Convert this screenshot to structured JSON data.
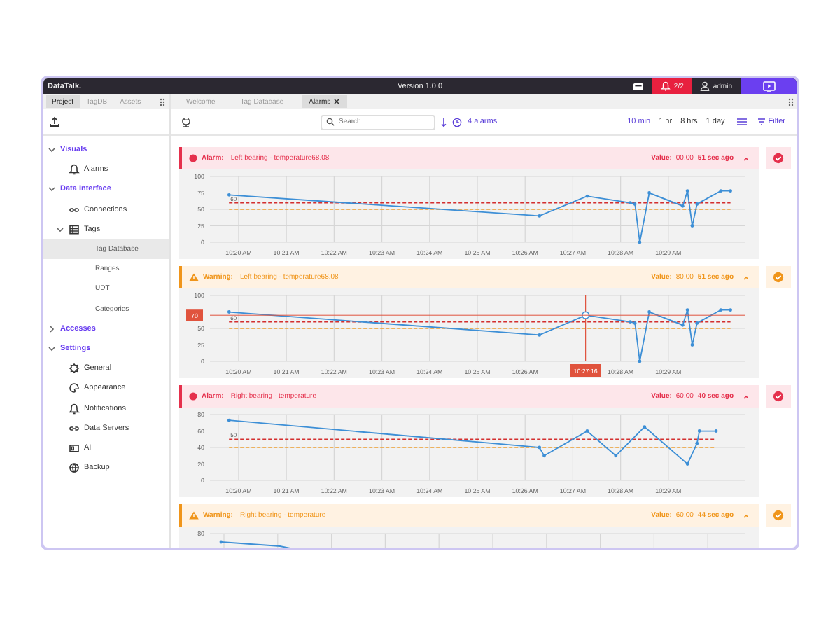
{
  "app": {
    "name": "DataTalk.",
    "version": "Version 1.0.0",
    "alarm_count": "2/2",
    "user": "admin"
  },
  "sidebar": {
    "tabs": [
      {
        "label": "Project",
        "selected": true
      },
      {
        "label": "TagDB",
        "selected": false
      },
      {
        "label": "Assets",
        "selected": false
      }
    ],
    "tree": [
      {
        "label": "Visuals",
        "selected": false,
        "expanded": true,
        "children": [
          {
            "label": "Alarms",
            "selected": false
          }
        ]
      },
      {
        "label": "Data Interface",
        "selected": false,
        "expanded": true,
        "children": [
          {
            "label": "Connections",
            "selected": false
          },
          {
            "label": "Tags",
            "selected": false,
            "expanded": true,
            "children": [
              {
                "label": "Tag Database",
                "selected": true
              },
              {
                "label": "Ranges",
                "selected": false
              },
              {
                "label": "UDT",
                "selected": false
              },
              {
                "label": "Categories",
                "selected": false
              }
            ]
          }
        ]
      },
      {
        "label": "Accesses",
        "selected": false,
        "expanded": false
      },
      {
        "label": "Settings",
        "selected": false,
        "expanded": true,
        "children": [
          {
            "label": "General",
            "selected": false
          },
          {
            "label": "Appearance",
            "selected": false
          },
          {
            "label": "Notifications",
            "selected": false
          },
          {
            "label": "Data Servers",
            "selected": false
          },
          {
            "label": "AI",
            "selected": false
          },
          {
            "label": "Backup",
            "selected": false
          }
        ]
      }
    ]
  },
  "tabs": [
    {
      "label": "Welcome",
      "selected": false,
      "closable": false
    },
    {
      "label": "Tag Database",
      "selected": false,
      "closable": false
    },
    {
      "label": "Alarms",
      "selected": true,
      "closable": true
    }
  ],
  "toolbar": {
    "search": {
      "placeholder": "Search..."
    },
    "alarm_count": "4 alarms",
    "ranges": [
      {
        "label": "10 min",
        "selected": true
      },
      {
        "label": "1 hr",
        "selected": false
      },
      {
        "label": "8 hrs",
        "selected": false
      },
      {
        "label": "1 day",
        "selected": false
      }
    ],
    "filter": "Filter"
  },
  "alarms": [
    {
      "kind": "alarm",
      "severity_label": "Alarm:",
      "tag": "Left bearing - temperature68.08",
      "value_label": "Value:",
      "value": "00.00",
      "age": "51 sec ago",
      "expanded": true,
      "chart_data": {
        "type": "line",
        "grid": true,
        "x": [
          619.8,
          626.3,
          627.3,
          628.2,
          628.3,
          628.4,
          628.6,
          629.3,
          629.4,
          629.5,
          629.6,
          630.1,
          630.3
        ],
        "series": [
          {
            "color": "#3d8fd6",
            "values": [
              72,
              40,
              70,
              60,
              58,
              0,
              75,
              55,
              78,
              25,
              58,
              78,
              78
            ]
          },
          {
            "name": "60",
            "color": "#d32f2f",
            "line_style": "dashed",
            "values": [
              60,
              60,
              60,
              60,
              60,
              60,
              60,
              60,
              60,
              60,
              60,
              60,
              60
            ]
          },
          {
            "color": "#f0a030",
            "line_style": "dashed",
            "values": [
              50,
              50,
              50,
              50,
              50,
              50,
              50,
              50,
              50,
              50,
              50,
              50,
              50
            ]
          }
        ],
        "xlim": [
          619.4,
          630.6
        ],
        "ylim": [
          0,
          100
        ],
        "xticks": [
          {
            "value": 620,
            "label": "10:20 AM"
          },
          {
            "value": 621,
            "label": "10:21 AM"
          },
          {
            "value": 622,
            "label": "10:22 AM"
          },
          {
            "value": 623,
            "label": "10:23 AM"
          },
          {
            "value": 624,
            "label": "10:24 AM"
          },
          {
            "value": 625,
            "label": "10:25 AM"
          },
          {
            "value": 626,
            "label": "10:26 AM"
          },
          {
            "value": 627,
            "label": "10:27 AM"
          },
          {
            "value": 628,
            "label": "10:28 AM"
          },
          {
            "value": 629,
            "label": "10:29 AM"
          }
        ],
        "yticks": [
          0,
          25,
          50,
          75,
          100
        ]
      }
    },
    {
      "kind": "warning",
      "severity_label": "Warning:",
      "tag": "Left bearing - temperature68.08",
      "value_label": "Value:",
      "value": "80.00",
      "age": "51 sec ago",
      "expanded": true,
      "chart_data": {
        "type": "line",
        "grid": true,
        "x": [
          619.8,
          626.3,
          627.27,
          628.2,
          628.3,
          628.4,
          628.6,
          629.3,
          629.4,
          629.5,
          629.6,
          630.1,
          630.3
        ],
        "series": [
          {
            "color": "#3d8fd6",
            "values": [
              75,
              40,
              70,
              60,
              58,
              0,
              75,
              55,
              78,
              25,
              58,
              78,
              78
            ]
          },
          {
            "name": "60",
            "color": "#d32f2f",
            "line_style": "dashed",
            "values": [
              60,
              60,
              60,
              60,
              60,
              60,
              60,
              60,
              60,
              60,
              60,
              60,
              60
            ]
          },
          {
            "color": "#f0a030",
            "line_style": "dashed",
            "values": [
              50,
              50,
              50,
              50,
              50,
              50,
              50,
              50,
              50,
              50,
              50,
              50,
              50
            ]
          }
        ],
        "xlim": [
          619.4,
          630.6
        ],
        "ylim": [
          0,
          100
        ],
        "xticks": [
          {
            "value": 620,
            "label": "10:20 AM"
          },
          {
            "value": 621,
            "label": "10:21 AM"
          },
          {
            "value": 622,
            "label": "10:22 AM"
          },
          {
            "value": 623,
            "label": "10:23 AM"
          },
          {
            "value": 624,
            "label": "10:24 AM"
          },
          {
            "value": 625,
            "label": "10:25 AM"
          },
          {
            "value": 626,
            "label": "10:26 AM"
          },
          {
            "value": 628,
            "label": "10:28 AM"
          },
          {
            "value": 629,
            "label": "10:29 AM"
          }
        ],
        "yticks": [
          0,
          25,
          50,
          100
        ],
        "annotations": [
          "10:27:16",
          "70"
        ]
      }
    },
    {
      "kind": "alarm",
      "severity_label": "Alarm:",
      "tag": "Right bearing - temperature",
      "value_label": "Value:",
      "value": "60.00",
      "age": "40 sec ago",
      "expanded": true,
      "chart_data": {
        "type": "line",
        "grid": true,
        "x": [
          619.8,
          626.3,
          626.4,
          627.3,
          627.9,
          628.5,
          629.4,
          629.6,
          629.65,
          630.0
        ],
        "series": [
          {
            "color": "#3d8fd6",
            "values": [
              73,
              40,
              30,
              60,
              30,
              65,
              20,
              45,
              60,
              60
            ]
          },
          {
            "name": "50",
            "color": "#d32f2f",
            "line_style": "dashed",
            "values": [
              50,
              50,
              50,
              50,
              50,
              50,
              50,
              50,
              50,
              50
            ]
          },
          {
            "color": "#f0a030",
            "line_style": "dashed",
            "values": [
              40,
              40,
              40,
              40,
              40,
              40,
              40,
              40,
              40,
              40
            ]
          }
        ],
        "xlim": [
          619.4,
          630.6
        ],
        "ylim": [
          0,
          80
        ],
        "xticks": [
          {
            "value": 620,
            "label": "10:20 AM"
          },
          {
            "value": 621,
            "label": "10:21 AM"
          },
          {
            "value": 622,
            "label": "10:22 AM"
          },
          {
            "value": 623,
            "label": "10:23 AM"
          },
          {
            "value": 624,
            "label": "10:24 AM"
          },
          {
            "value": 625,
            "label": "10:25 AM"
          },
          {
            "value": 626,
            "label": "10:26 AM"
          },
          {
            "value": 627,
            "label": "10:27 AM"
          },
          {
            "value": 628,
            "label": "10:28 AM"
          },
          {
            "value": 629,
            "label": "10:29 AM"
          }
        ],
        "yticks": [
          0,
          20,
          40,
          60,
          80
        ]
      }
    },
    {
      "kind": "warning",
      "severity_label": "Warning:",
      "tag": "Right bearing - temperature",
      "value_label": "Value:",
      "value": "60.00",
      "age": "44 sec ago",
      "expanded": true,
      "plot_top_label": "80"
    }
  ]
}
